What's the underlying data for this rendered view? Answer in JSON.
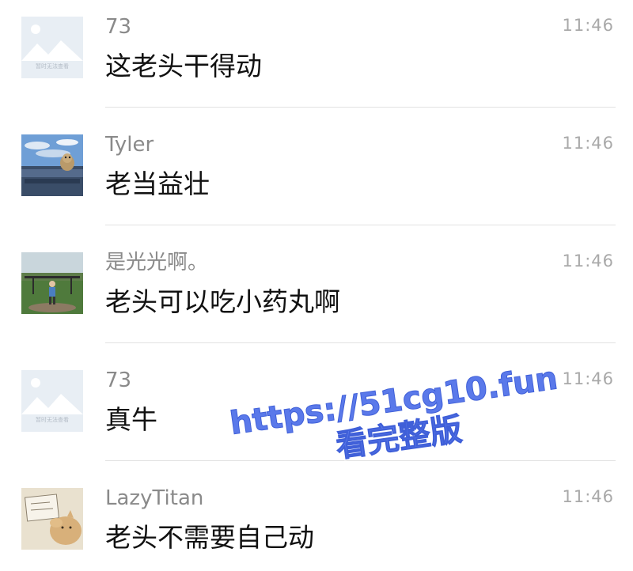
{
  "comments": [
    {
      "name": "73",
      "time": "11:46",
      "text": "这老头干得动",
      "avatar": "placeholder-avatar",
      "avatar_caption": "暂时无法查看"
    },
    {
      "name": "Tyler",
      "time": "11:46",
      "text": "老当益壮",
      "avatar": "dog-in-truck-avatar"
    },
    {
      "name": "是光光啊。",
      "time": "11:46",
      "text": "老头可以吃小药丸啊",
      "avatar": "child-at-field-avatar"
    },
    {
      "name": "73",
      "time": "11:46",
      "text": "真牛",
      "avatar": "placeholder-avatar",
      "avatar_caption": "暂时无法查看"
    },
    {
      "name": "LazyTitan",
      "time": "11:46",
      "text": "老头不需要自己动",
      "avatar": "cartoon-cat-avatar"
    }
  ],
  "watermark": {
    "url": "https://51cg10.fun",
    "subtitle": "看完整版"
  },
  "colors": {
    "name": "#8a8a8a",
    "time": "#a9a9a9",
    "text": "#111111",
    "divider": "#e2e2e2",
    "watermark": "#5a79ea"
  }
}
